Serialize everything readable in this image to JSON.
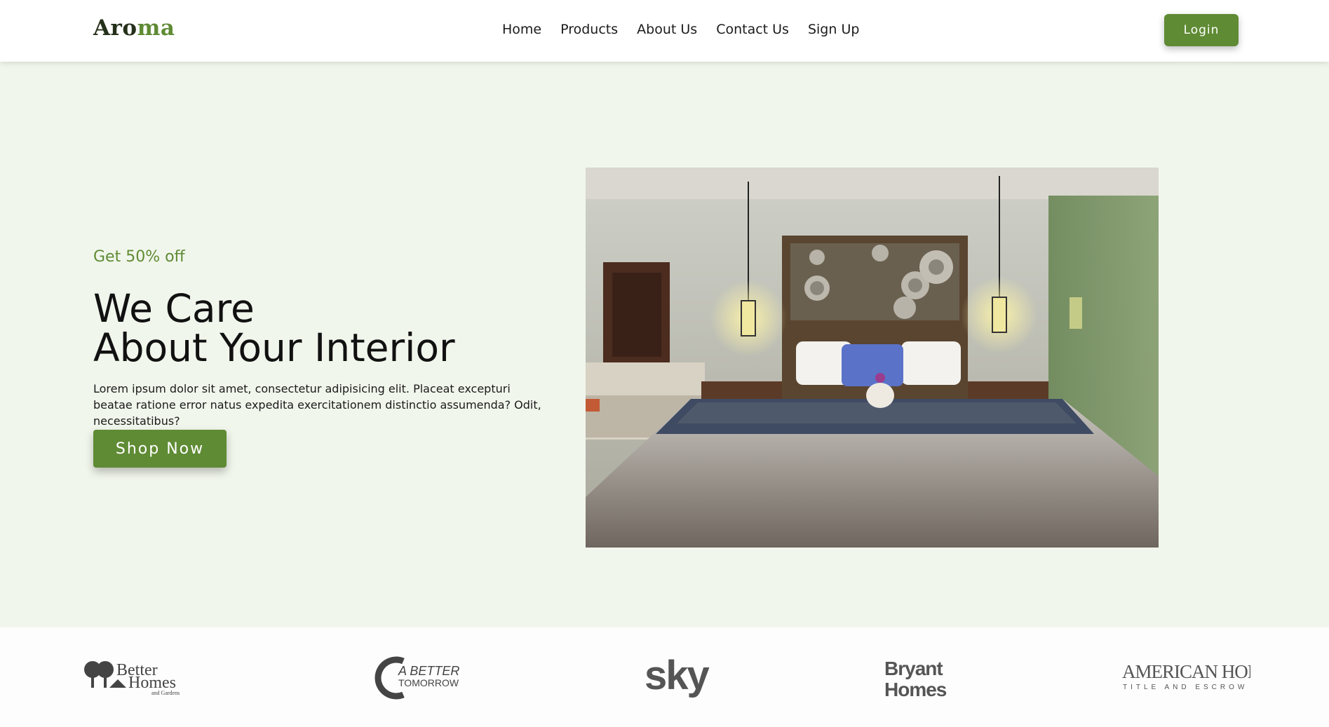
{
  "header": {
    "logo_part1": "Aro",
    "logo_part2": "ma",
    "nav": [
      "Home",
      "Products",
      "About Us",
      "Contact Us",
      "Sign Up"
    ],
    "login_label": "Login"
  },
  "hero": {
    "promo": "Get 50% off",
    "headline_line1": "We Care",
    "headline_line2": "About Your Interior",
    "description": "Lorem ipsum dolor sit amet, consectetur adipisicing elit. Placeat excepturi beatae ratione error natus expedita exercitationem distinctio assumenda? Odit, necessitatibus?",
    "cta_label": "Shop Now"
  },
  "brands": {
    "better_homes": {
      "line1": "Better",
      "line2": "Homes",
      "line3": "and Gardens"
    },
    "a_better_tomorrow": {
      "line1": "A BETTER",
      "line2": "TOMORROW"
    },
    "sky": {
      "text": "sky"
    },
    "bryant_homes": {
      "line1": "Bryant",
      "line2": "Homes"
    },
    "american_home": {
      "line1": "AMERICAN HOME",
      "line2": "TITLE AND ESCROW"
    }
  },
  "colors": {
    "accent": "#5f8b34",
    "hero_bg": "#f1f6ec",
    "logo_dark": "#25301a"
  }
}
